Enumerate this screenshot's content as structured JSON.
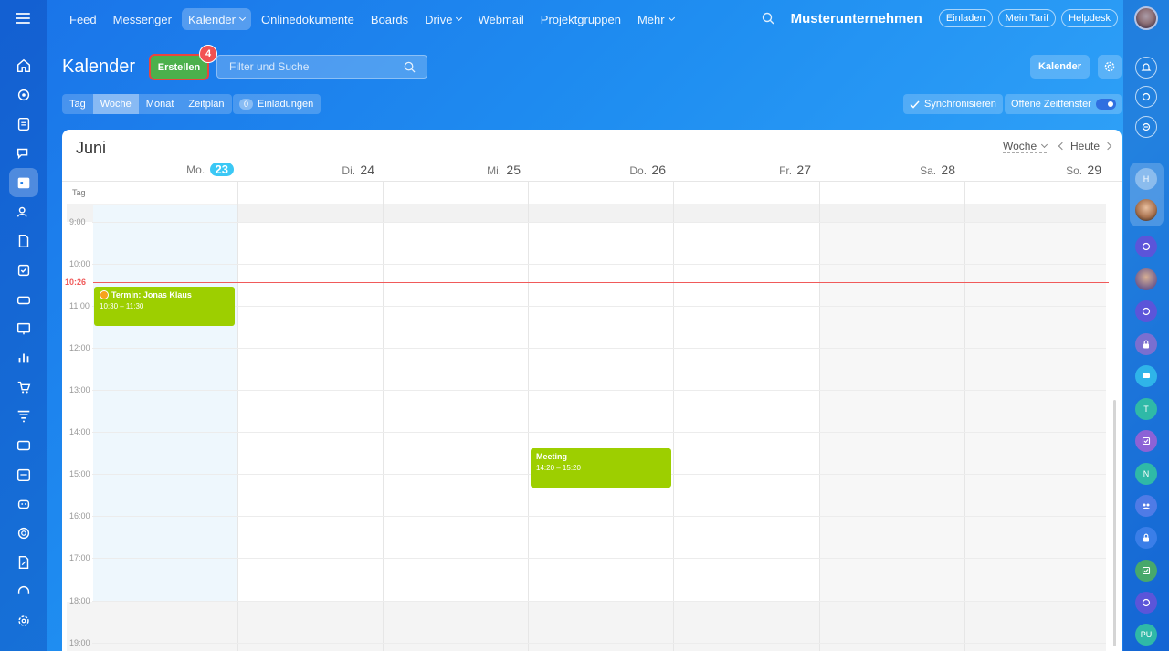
{
  "topnav": {
    "items": [
      {
        "label": "Feed"
      },
      {
        "label": "Messenger"
      },
      {
        "label": "Kalender"
      },
      {
        "label": "Onlinedokumente"
      },
      {
        "label": "Boards"
      },
      {
        "label": "Drive"
      },
      {
        "label": "Webmail"
      },
      {
        "label": "Projektgruppen"
      },
      {
        "label": "Mehr"
      }
    ],
    "active": "Kalender",
    "company": "Musterunternehmen",
    "invite_label": "Einladen",
    "tariff_label": "Mein Tarif",
    "help_label": "Helpdesk"
  },
  "header": {
    "title": "Kalender",
    "create_label": "Erstellen",
    "create_badge": "4",
    "search_placeholder": "Filter und Suche",
    "calendar_button": "Kalender"
  },
  "views": {
    "tabs": [
      {
        "label": "Tag"
      },
      {
        "label": "Woche"
      },
      {
        "label": "Monat"
      },
      {
        "label": "Zeitplan"
      }
    ],
    "active": "Woche",
    "invitations_count": "0",
    "invitations_label": "Einladungen",
    "sync_label": "Synchronisieren",
    "free_slots_label": "Offene Zeitfenster"
  },
  "calendar": {
    "month": "Juni",
    "week_selector": "Woche",
    "today_label": "Heute",
    "days": [
      {
        "name": "Mo.",
        "num": "23"
      },
      {
        "name": "Di.",
        "num": "24"
      },
      {
        "name": "Mi.",
        "num": "25"
      },
      {
        "name": "Do.",
        "num": "26"
      },
      {
        "name": "Fr.",
        "num": "27"
      },
      {
        "name": "Sa.",
        "num": "28"
      },
      {
        "name": "So.",
        "num": "29"
      }
    ],
    "allday_label": "Tag",
    "hours": [
      "9:00",
      "10:00",
      "11:00",
      "12:00",
      "13:00",
      "14:00",
      "15:00",
      "16:00",
      "17:00",
      "18:00",
      "19:00"
    ],
    "now_label": "10:26",
    "events": [
      {
        "title": "Termin: Jonas Klaus",
        "time": "10:30 – 11:30"
      },
      {
        "title": "Meeting",
        "time": "14:20 – 15:20"
      }
    ]
  },
  "right_bar": {
    "initials": [
      "H",
      "T",
      "N",
      "PU"
    ]
  },
  "colors": {
    "accent": "#3bc8f5",
    "create": "#4cb04c",
    "event": "#9dcf00",
    "now_line": "#f05a5a"
  }
}
